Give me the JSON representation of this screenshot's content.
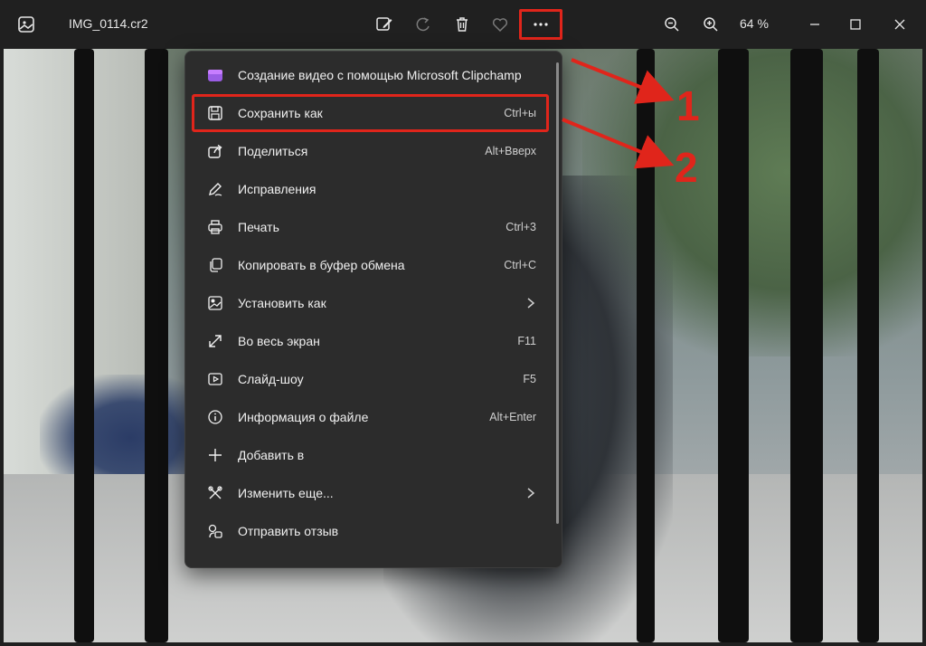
{
  "window": {
    "file_name": "IMG_0114.cr2",
    "zoom": "64 %"
  },
  "toolbar": {
    "icons": [
      "gallery-icon",
      "edit-image-icon",
      "rotate-icon",
      "delete-icon",
      "favorite-icon",
      "more-options-icon",
      "zoom-out-icon",
      "zoom-in-icon",
      "minimize-icon",
      "maximize-icon",
      "close-icon"
    ]
  },
  "menu": {
    "items": [
      {
        "label": "Создание видео с помощью Microsoft Clipchamp",
        "shortcut": ""
      },
      {
        "label": "Сохранить как",
        "shortcut": "Ctrl+ы"
      },
      {
        "label": "Поделиться",
        "shortcut": "Alt+Вверх"
      },
      {
        "label": "Исправления",
        "shortcut": ""
      },
      {
        "label": "Печать",
        "shortcut": "Ctrl+3"
      },
      {
        "label": "Копировать в буфер обмена",
        "shortcut": "Ctrl+C"
      },
      {
        "label": "Установить как",
        "shortcut": ""
      },
      {
        "label": "Во весь экран",
        "shortcut": "F11"
      },
      {
        "label": "Слайд-шоу",
        "shortcut": "F5"
      },
      {
        "label": "Информация о файле",
        "shortcut": "Alt+Enter"
      },
      {
        "label": "Добавить в",
        "shortcut": ""
      },
      {
        "label": "Изменить еще...",
        "shortcut": ""
      },
      {
        "label": "Отправить отзыв",
        "shortcut": ""
      }
    ]
  },
  "annotations": {
    "one": "1",
    "two": "2",
    "color": "#e0251b"
  }
}
